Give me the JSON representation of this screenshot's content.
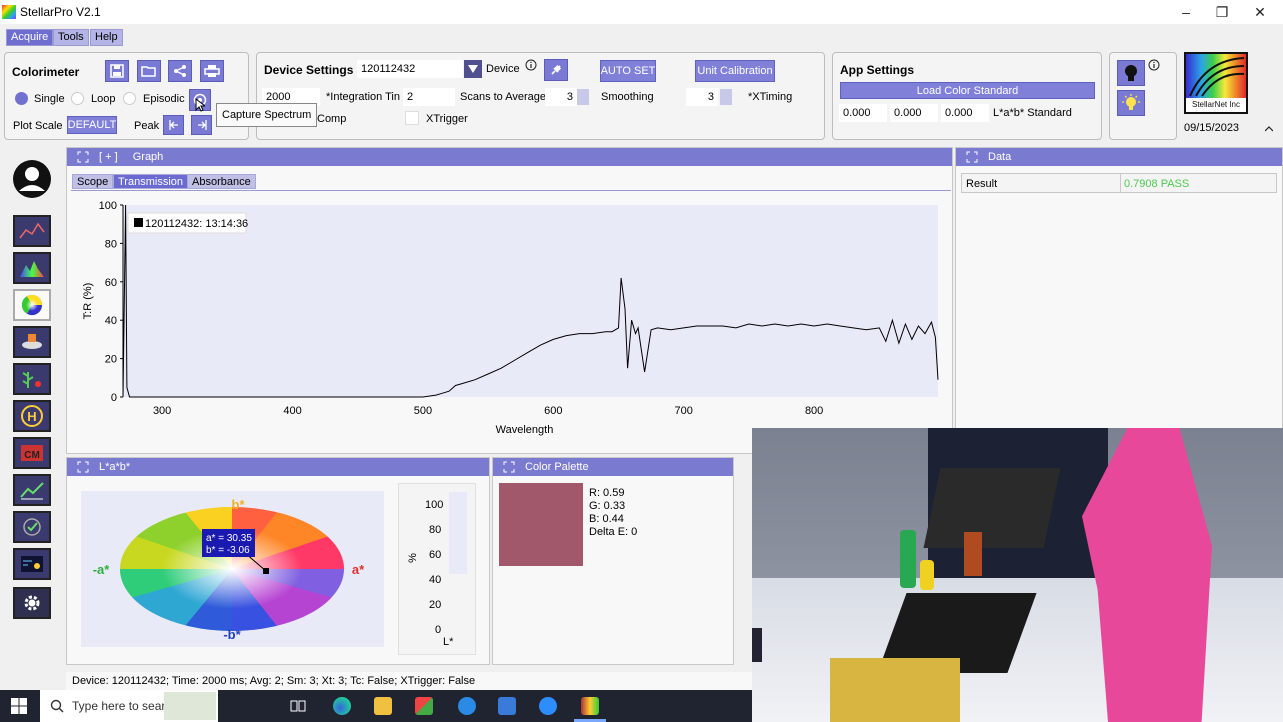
{
  "app": {
    "title": "StellarPro V2.1"
  },
  "menu": {
    "acquire": "Acquire",
    "tools": "Tools",
    "help": "Help"
  },
  "colorimeter": {
    "title": "Colorimeter",
    "modes": [
      "Single",
      "Loop",
      "Episodic"
    ],
    "selected_mode": "Single",
    "plot_scale_label": "Plot Scale",
    "plot_scale_value": "DEFAULT",
    "peak_label": "Peak",
    "tooltip": "Capture Spectrum"
  },
  "device_settings": {
    "title": "Device Settings",
    "device_id": "120112432",
    "device_label": "Device",
    "auto_set": "AUTO SET",
    "unit_calibration": "Unit Calibration",
    "integration_time_value": "2000",
    "integration_time_label": "*Integration Tin",
    "scans_value": "2",
    "scans_label": "Scans to Average",
    "smoothing_value": "3",
    "smoothing_label": "Smoothing",
    "xtiming_value": "3",
    "xtiming_label": "*XTiming",
    "temp_comp_label": "Comp",
    "xtrigger_label": "XTrigger"
  },
  "app_settings": {
    "title": "App Settings",
    "load_color_standard": "Load Color Standard",
    "std_values": [
      "0.000",
      "0.000",
      "0.000"
    ],
    "std_label": "L*a*b* Standard"
  },
  "logo": {
    "text": "StellarNet Inc",
    "date": "09/15/2023"
  },
  "graph": {
    "title": "Graph",
    "prefix": "[ + ]",
    "tabs": [
      "Scope",
      "Transmission",
      "Absorbance"
    ],
    "active_tab": "Transmission",
    "legend": "120112432:  13:14:36"
  },
  "data_panel": {
    "title": "Data",
    "rows": [
      {
        "label": "Result",
        "value": "0.7908 PASS"
      }
    ]
  },
  "lab_panel": {
    "title": "L*a*b*",
    "a_value": "a* = 30.35",
    "b_value": "b* = -3.06",
    "axis_b_pos": "b*",
    "axis_b_neg": "-b*",
    "axis_a_pos": "a*",
    "axis_a_neg": "-a*",
    "l_axis_label": "L*",
    "l_unit": "%",
    "l_ticks": [
      "100",
      "80",
      "60",
      "40",
      "20",
      "0"
    ]
  },
  "color_palette": {
    "title": "Color Palette",
    "swatch": "#a0586a",
    "r": "R: 0.59",
    "g": "G: 0.33",
    "b": "B: 0.44",
    "delta_e": "Delta E: 0"
  },
  "status": {
    "text": "Device: 120112432; Time: 2000 ms; Avg: 2; Sm: 3; Xt: 3; Tc: False; XTrigger: False"
  },
  "taskbar": {
    "search_placeholder": "Type here to search"
  },
  "colors": {
    "accent": "#7a7ad0",
    "pass": "#4ec84e",
    "line": "#000000"
  },
  "chart_data": {
    "type": "line",
    "title": "",
    "xlabel": "Wavelength",
    "ylabel": "T:R (%)",
    "xlim": [
      270,
      895
    ],
    "ylim": [
      0,
      100
    ],
    "x_ticks": [
      300,
      400,
      500,
      600,
      700,
      800
    ],
    "y_ticks": [
      0,
      20,
      40,
      60,
      80,
      100
    ],
    "legend_position": "top-left",
    "series": [
      {
        "name": "120112432:  13:14:36",
        "x": [
          270,
          272,
          273,
          275,
          280,
          300,
          350,
          400,
          450,
          480,
          500,
          510,
          515,
          520,
          525,
          530,
          540,
          550,
          560,
          570,
          580,
          590,
          600,
          610,
          620,
          630,
          640,
          645,
          650,
          652,
          655,
          657,
          660,
          663,
          665,
          670,
          675,
          680,
          690,
          700,
          710,
          720,
          730,
          740,
          750,
          760,
          770,
          780,
          790,
          800,
          810,
          820,
          830,
          840,
          850,
          855,
          860,
          865,
          870,
          875,
          880,
          885,
          890,
          893,
          895
        ],
        "y": [
          0,
          100,
          5,
          0,
          0,
          0,
          0,
          0,
          0,
          0,
          0,
          1,
          2,
          3,
          6,
          7,
          9,
          12,
          15,
          19,
          23,
          27,
          30,
          32,
          33,
          33,
          34,
          34,
          36,
          62,
          46,
          15,
          40,
          33,
          36,
          13,
          35,
          36,
          35,
          36,
          37,
          37,
          37,
          36,
          38,
          37,
          38,
          37,
          38,
          37,
          38,
          37,
          36,
          35,
          36,
          29,
          40,
          28,
          38,
          30,
          37,
          33,
          39,
          31,
          9
        ]
      }
    ]
  }
}
